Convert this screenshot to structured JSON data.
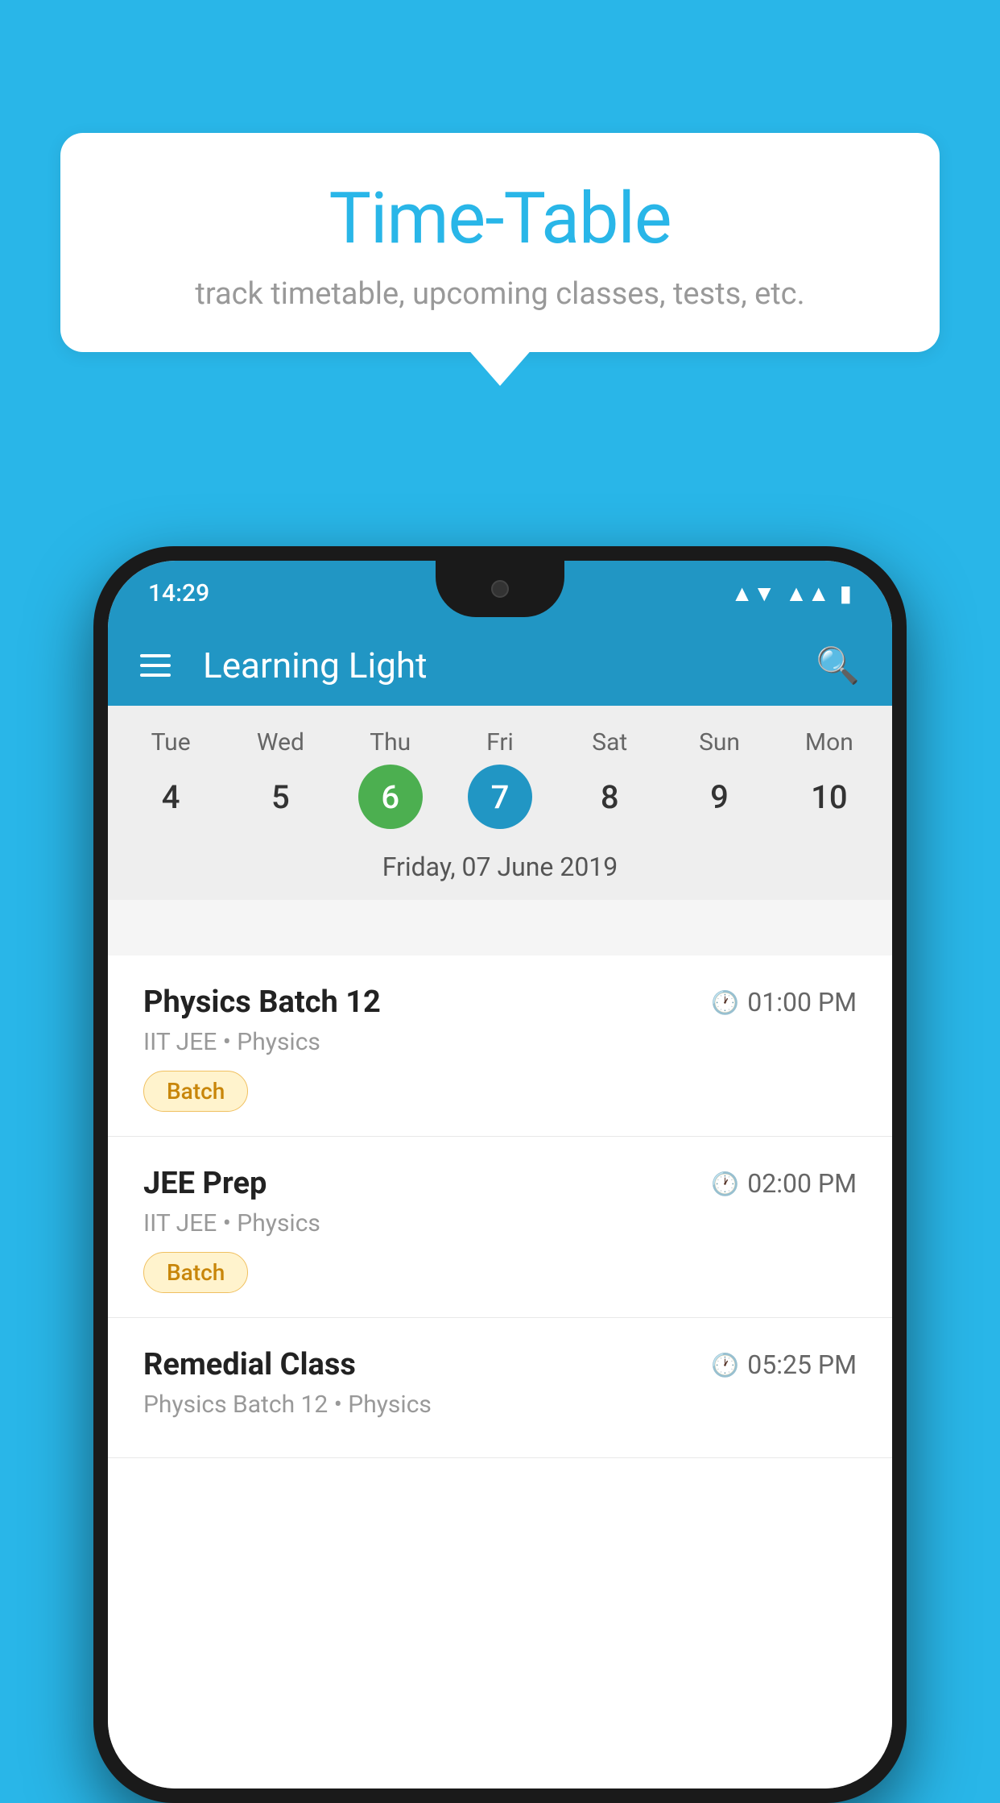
{
  "background_color": "#29b6e8",
  "tooltip": {
    "title": "Time-Table",
    "subtitle": "track timetable, upcoming classes, tests, etc."
  },
  "phone": {
    "status_bar": {
      "time": "14:29",
      "wifi": "▾",
      "signal": "▲",
      "battery": "▐"
    },
    "app_bar": {
      "title": "Learning Light",
      "menu_label": "Menu",
      "search_label": "Search"
    },
    "calendar": {
      "days": [
        {
          "name": "Tue",
          "number": "4",
          "state": "normal"
        },
        {
          "name": "Wed",
          "number": "5",
          "state": "normal"
        },
        {
          "name": "Thu",
          "number": "6",
          "state": "today"
        },
        {
          "name": "Fri",
          "number": "7",
          "state": "selected"
        },
        {
          "name": "Sat",
          "number": "8",
          "state": "normal"
        },
        {
          "name": "Sun",
          "number": "9",
          "state": "normal"
        },
        {
          "name": "Mon",
          "number": "10",
          "state": "normal"
        }
      ],
      "selected_date_label": "Friday, 07 June 2019"
    },
    "classes": [
      {
        "name": "Physics Batch 12",
        "time": "01:00 PM",
        "meta": "IIT JEE • Physics",
        "badge": "Batch"
      },
      {
        "name": "JEE Prep",
        "time": "02:00 PM",
        "meta": "IIT JEE • Physics",
        "badge": "Batch"
      },
      {
        "name": "Remedial Class",
        "time": "05:25 PM",
        "meta": "Physics Batch 12 • Physics",
        "badge": null
      }
    ]
  }
}
